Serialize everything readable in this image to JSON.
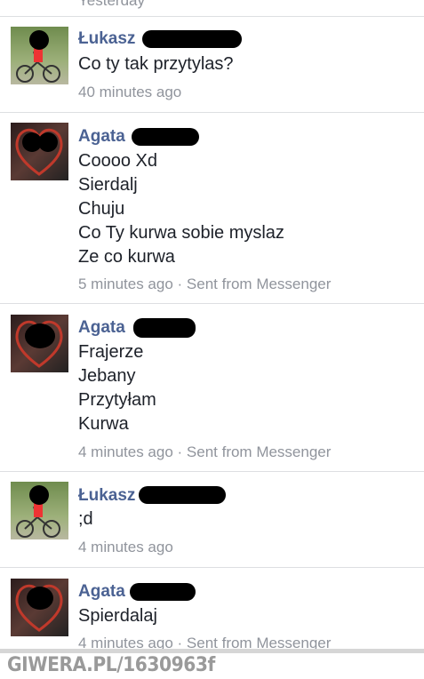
{
  "thread": {
    "top_fragment": "Yesterday",
    "messages": [
      {
        "sender": "Łukasz",
        "lines": [
          "Co ty tak przytylas?"
        ],
        "meta": "40 minutes ago"
      },
      {
        "sender": "Agata",
        "lines": [
          "Coooo Xd",
          "Sierdalj",
          "Chuju",
          "Co Ty kurwa sobie myslaz",
          "Ze co kurwa"
        ],
        "meta": "5 minutes ago · Sent from Messenger"
      },
      {
        "sender": "Agata",
        "lines": [
          "Frajerze",
          "Jebany",
          "Przytyłam",
          "Kurwa"
        ],
        "meta": "4 minutes ago · Sent from Messenger"
      },
      {
        "sender": "Łukasz",
        "lines": [
          ";d"
        ],
        "meta": "4 minutes ago"
      },
      {
        "sender": "Agata",
        "lines": [
          "Spierdalaj"
        ],
        "meta": "4 minutes ago · Sent from Messenger"
      }
    ]
  },
  "footer": {
    "watermark": "GIWERA.PL/1630963f"
  },
  "colors": {
    "sender": "#4b6293",
    "text": "#1d2129",
    "meta": "#90949c",
    "divider": "#dddfe2"
  }
}
